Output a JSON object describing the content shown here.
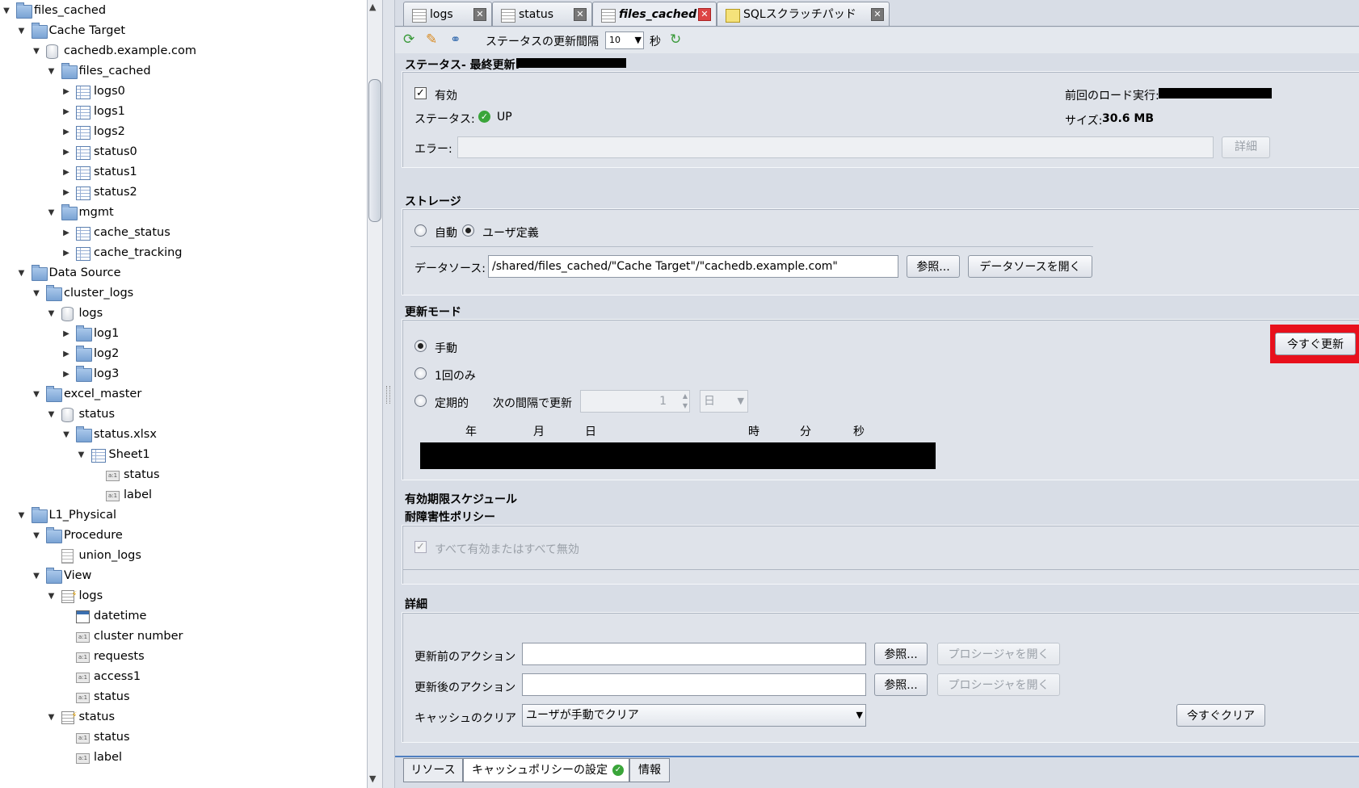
{
  "tree": [
    {
      "label": "files_cached",
      "icon": "folder-icon",
      "level": 0,
      "arrow": "▼"
    },
    {
      "label": "Cache Target",
      "icon": "folder-icon",
      "level": 1,
      "arrow": "▼"
    },
    {
      "label": "cachedb.example.com",
      "icon": "database-icon",
      "level": 2,
      "arrow": "▼"
    },
    {
      "label": "files_cached",
      "icon": "folder-icon",
      "level": 3,
      "arrow": "▼"
    },
    {
      "label": "logs0",
      "icon": "table-icon",
      "level": 4,
      "arrow": "▶"
    },
    {
      "label": "logs1",
      "icon": "table-icon",
      "level": 4,
      "arrow": "▶"
    },
    {
      "label": "logs2",
      "icon": "table-icon",
      "level": 4,
      "arrow": "▶"
    },
    {
      "label": "status0",
      "icon": "table-icon",
      "level": 4,
      "arrow": "▶"
    },
    {
      "label": "status1",
      "icon": "table-icon",
      "level": 4,
      "arrow": "▶"
    },
    {
      "label": "status2",
      "icon": "table-icon",
      "level": 4,
      "arrow": "▶"
    },
    {
      "label": "mgmt",
      "icon": "folder-icon",
      "level": 3,
      "arrow": "▼"
    },
    {
      "label": "cache_status",
      "icon": "table-icon",
      "level": 4,
      "arrow": "▶"
    },
    {
      "label": "cache_tracking",
      "icon": "table-icon",
      "level": 4,
      "arrow": "▶"
    },
    {
      "label": "Data Source",
      "icon": "folder-icon",
      "level": 1,
      "arrow": "▼"
    },
    {
      "label": "cluster_logs",
      "icon": "folder-icon",
      "level": 2,
      "arrow": "▼"
    },
    {
      "label": "logs",
      "icon": "database-icon",
      "level": 3,
      "arrow": "▼"
    },
    {
      "label": "log1",
      "icon": "folder-icon",
      "level": 4,
      "arrow": "▶"
    },
    {
      "label": "log2",
      "icon": "folder-icon",
      "level": 4,
      "arrow": "▶"
    },
    {
      "label": "log3",
      "icon": "folder-icon",
      "level": 4,
      "arrow": "▶"
    },
    {
      "label": "excel_master",
      "icon": "folder-icon",
      "level": 2,
      "arrow": "▼"
    },
    {
      "label": "status",
      "icon": "database-icon",
      "level": 3,
      "arrow": "▼"
    },
    {
      "label": "status.xlsx",
      "icon": "folder-icon",
      "level": 4,
      "arrow": "▼"
    },
    {
      "label": "Sheet1",
      "icon": "table-icon",
      "level": 5,
      "arrow": "▼"
    },
    {
      "label": "status",
      "icon": "column-icon",
      "level": 6,
      "arrow": ""
    },
    {
      "label": "label",
      "icon": "column-icon",
      "level": 6,
      "arrow": ""
    },
    {
      "label": "L1_Physical",
      "icon": "folder-icon",
      "level": 1,
      "arrow": "▼"
    },
    {
      "label": "Procedure",
      "icon": "folder-icon",
      "level": 2,
      "arrow": "▼"
    },
    {
      "label": "union_logs",
      "icon": "procedure-icon",
      "level": 3,
      "arrow": ""
    },
    {
      "label": "View",
      "icon": "folder-icon",
      "level": 2,
      "arrow": "▼"
    },
    {
      "label": "logs",
      "icon": "view-icon",
      "level": 3,
      "arrow": "▼"
    },
    {
      "label": "datetime",
      "icon": "calendar-icon",
      "level": 4,
      "arrow": ""
    },
    {
      "label": "cluster number",
      "icon": "column-icon",
      "level": 4,
      "arrow": ""
    },
    {
      "label": "requests",
      "icon": "column-icon",
      "level": 4,
      "arrow": ""
    },
    {
      "label": "access1",
      "icon": "column-icon",
      "level": 4,
      "arrow": ""
    },
    {
      "label": "status",
      "icon": "column-icon",
      "level": 4,
      "arrow": ""
    },
    {
      "label": "status",
      "icon": "view-icon",
      "level": 3,
      "arrow": "▼"
    },
    {
      "label": "status",
      "icon": "column-icon",
      "level": 4,
      "arrow": ""
    },
    {
      "label": "label",
      "icon": "column-icon",
      "level": 4,
      "arrow": ""
    }
  ],
  "tabs": [
    {
      "label": "logs",
      "active": false
    },
    {
      "label": "status",
      "active": false
    },
    {
      "label": "files_cached",
      "active": true
    },
    {
      "label": "SQLスクラッチパッド",
      "active": false
    }
  ],
  "toolbar": {
    "interval_label": "ステータスの更新間隔",
    "interval_value": "10",
    "interval_unit": "秒"
  },
  "status_section": {
    "title": "ステータス- 最終更新:",
    "enabled_label": "有効",
    "enabled_checked": true,
    "status_label": "ステータス:",
    "status_value": "UP",
    "last_load_label": "前回のロード実行:",
    "size_label": "サイズ:",
    "size_value": "30.6 MB",
    "error_label": "エラー:",
    "error_value": "",
    "details_button": "詳細"
  },
  "storage": {
    "title": "ストレージ",
    "auto_label": "自動",
    "user_label": "ユーザ定義",
    "selected": "user",
    "datasource_label": "データソース:",
    "datasource_value": "/shared/files_cached/\"Cache Target\"/\"cachedb.example.com\"",
    "browse_button": "参照...",
    "open_datasource_button": "データソースを開く"
  },
  "refresh_mode": {
    "title": "更新モード",
    "manual_label": "手動",
    "once_label": "1回のみ",
    "periodic_label": "定期的",
    "selected": "manual",
    "interval_label": "次の間隔で更新",
    "interval_value": "1",
    "interval_unit": "日",
    "refresh_now_button": "今すぐ更新",
    "date_headers": [
      "年",
      "月",
      "日",
      "時",
      "分",
      "秒"
    ]
  },
  "expiration": {
    "title": "有効期限スケジュール"
  },
  "fault_tolerance": {
    "title": "耐障害性ポリシー",
    "all_label": "すべて有効またはすべて無効"
  },
  "details": {
    "title": "詳細",
    "pre_action_label": "更新前のアクション",
    "post_action_label": "更新後のアクション",
    "pre_action_value": "",
    "post_action_value": "",
    "browse_button": "参照...",
    "open_procedure_button": "プロシージャを開く",
    "clear_label": "キャッシュのクリア",
    "clear_value": "ユーザが手動でクリア",
    "clear_now_button": "今すぐクリア"
  },
  "bottom_tabs": [
    {
      "label": "リソース"
    },
    {
      "label": "キャッシュポリシーの設定"
    },
    {
      "label": "情報"
    }
  ],
  "colors": {
    "highlight": "#e8101c",
    "status_ok": "#3aa53a"
  }
}
